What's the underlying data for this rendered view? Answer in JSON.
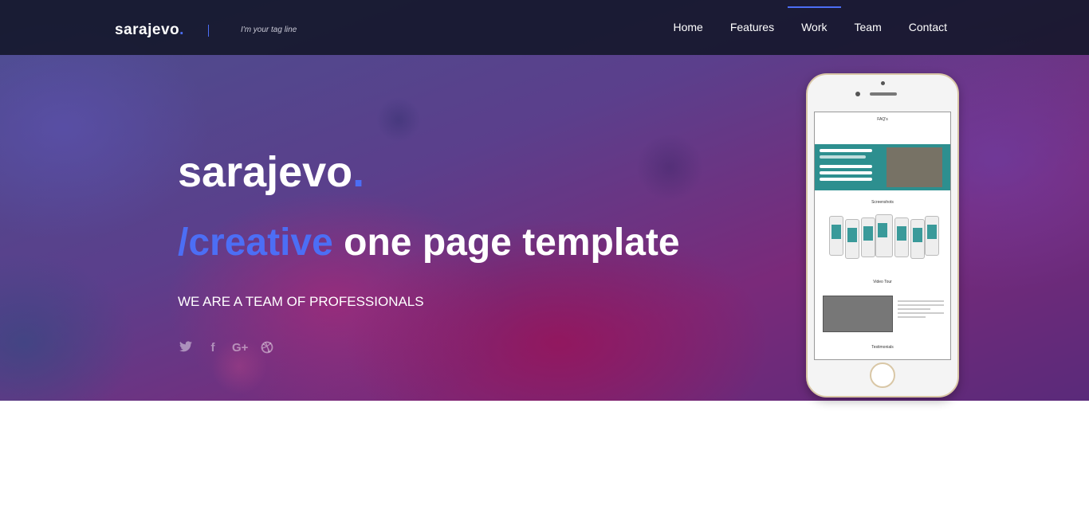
{
  "brand": {
    "name": "sarajevo",
    "dot": ".",
    "tagline": "I'm your tag line"
  },
  "nav": {
    "items": [
      {
        "label": "Home"
      },
      {
        "label": "Features"
      },
      {
        "label": "Work"
      },
      {
        "label": "Team"
      },
      {
        "label": "Contact"
      }
    ],
    "active": "Work"
  },
  "hero": {
    "title": "sarajevo",
    "title_dot": ".",
    "subtitle_accent": "/creative",
    "subtitle_rest": " one page template",
    "tagline": "WE ARE A TEAM OF PROFESSIONALS",
    "social": [
      {
        "icon": "twitter-icon",
        "glyph": "🐦"
      },
      {
        "icon": "facebook-icon",
        "glyph": "f"
      },
      {
        "icon": "google-plus-icon",
        "glyph": "G+"
      },
      {
        "icon": "dribbble-icon",
        "glyph": "◎"
      }
    ]
  },
  "phone_screen": {
    "faq_label": "FAQ's",
    "screenshots_label": "Screenshots",
    "video_label": "Video Tour",
    "testimonials_label": "Testimonials"
  },
  "colors": {
    "accent": "#4c6ef5",
    "navbar": "#121628"
  }
}
